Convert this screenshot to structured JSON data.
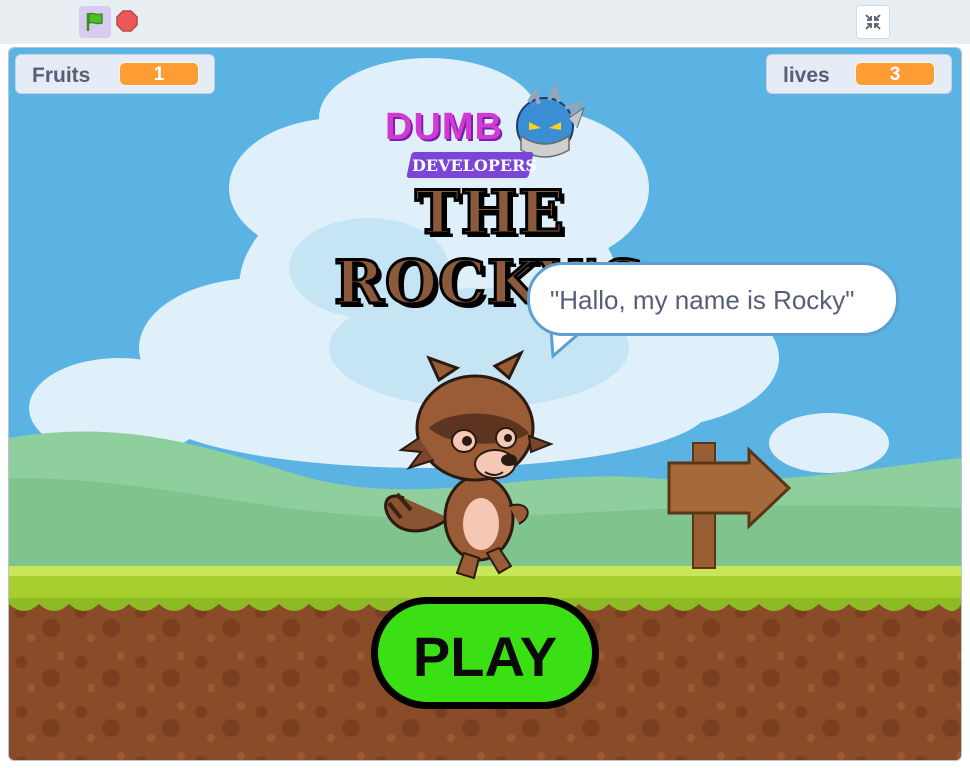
{
  "toolbar": {
    "green_flag_icon": "green-flag-icon",
    "stop_icon": "stop-sign-icon",
    "fullscreen_icon": "exit-fullscreen-icon"
  },
  "monitors": {
    "fruits": {
      "label": "Fruits",
      "value": "1"
    },
    "lives": {
      "label": "lives",
      "value": "3"
    }
  },
  "logo": {
    "top": "DUMB",
    "sub": "DEVELOPERS"
  },
  "title": "THE ROCKY'S",
  "speech": "\"Hallo, my name is Rocky\"",
  "play_button": "PLAY",
  "colors": {
    "sky": "#5ab3e2",
    "grass": "#a6cf2f",
    "dirt": "#8a4b28",
    "play_green": "#3be014",
    "monitor_orange": "#ff9c33"
  }
}
